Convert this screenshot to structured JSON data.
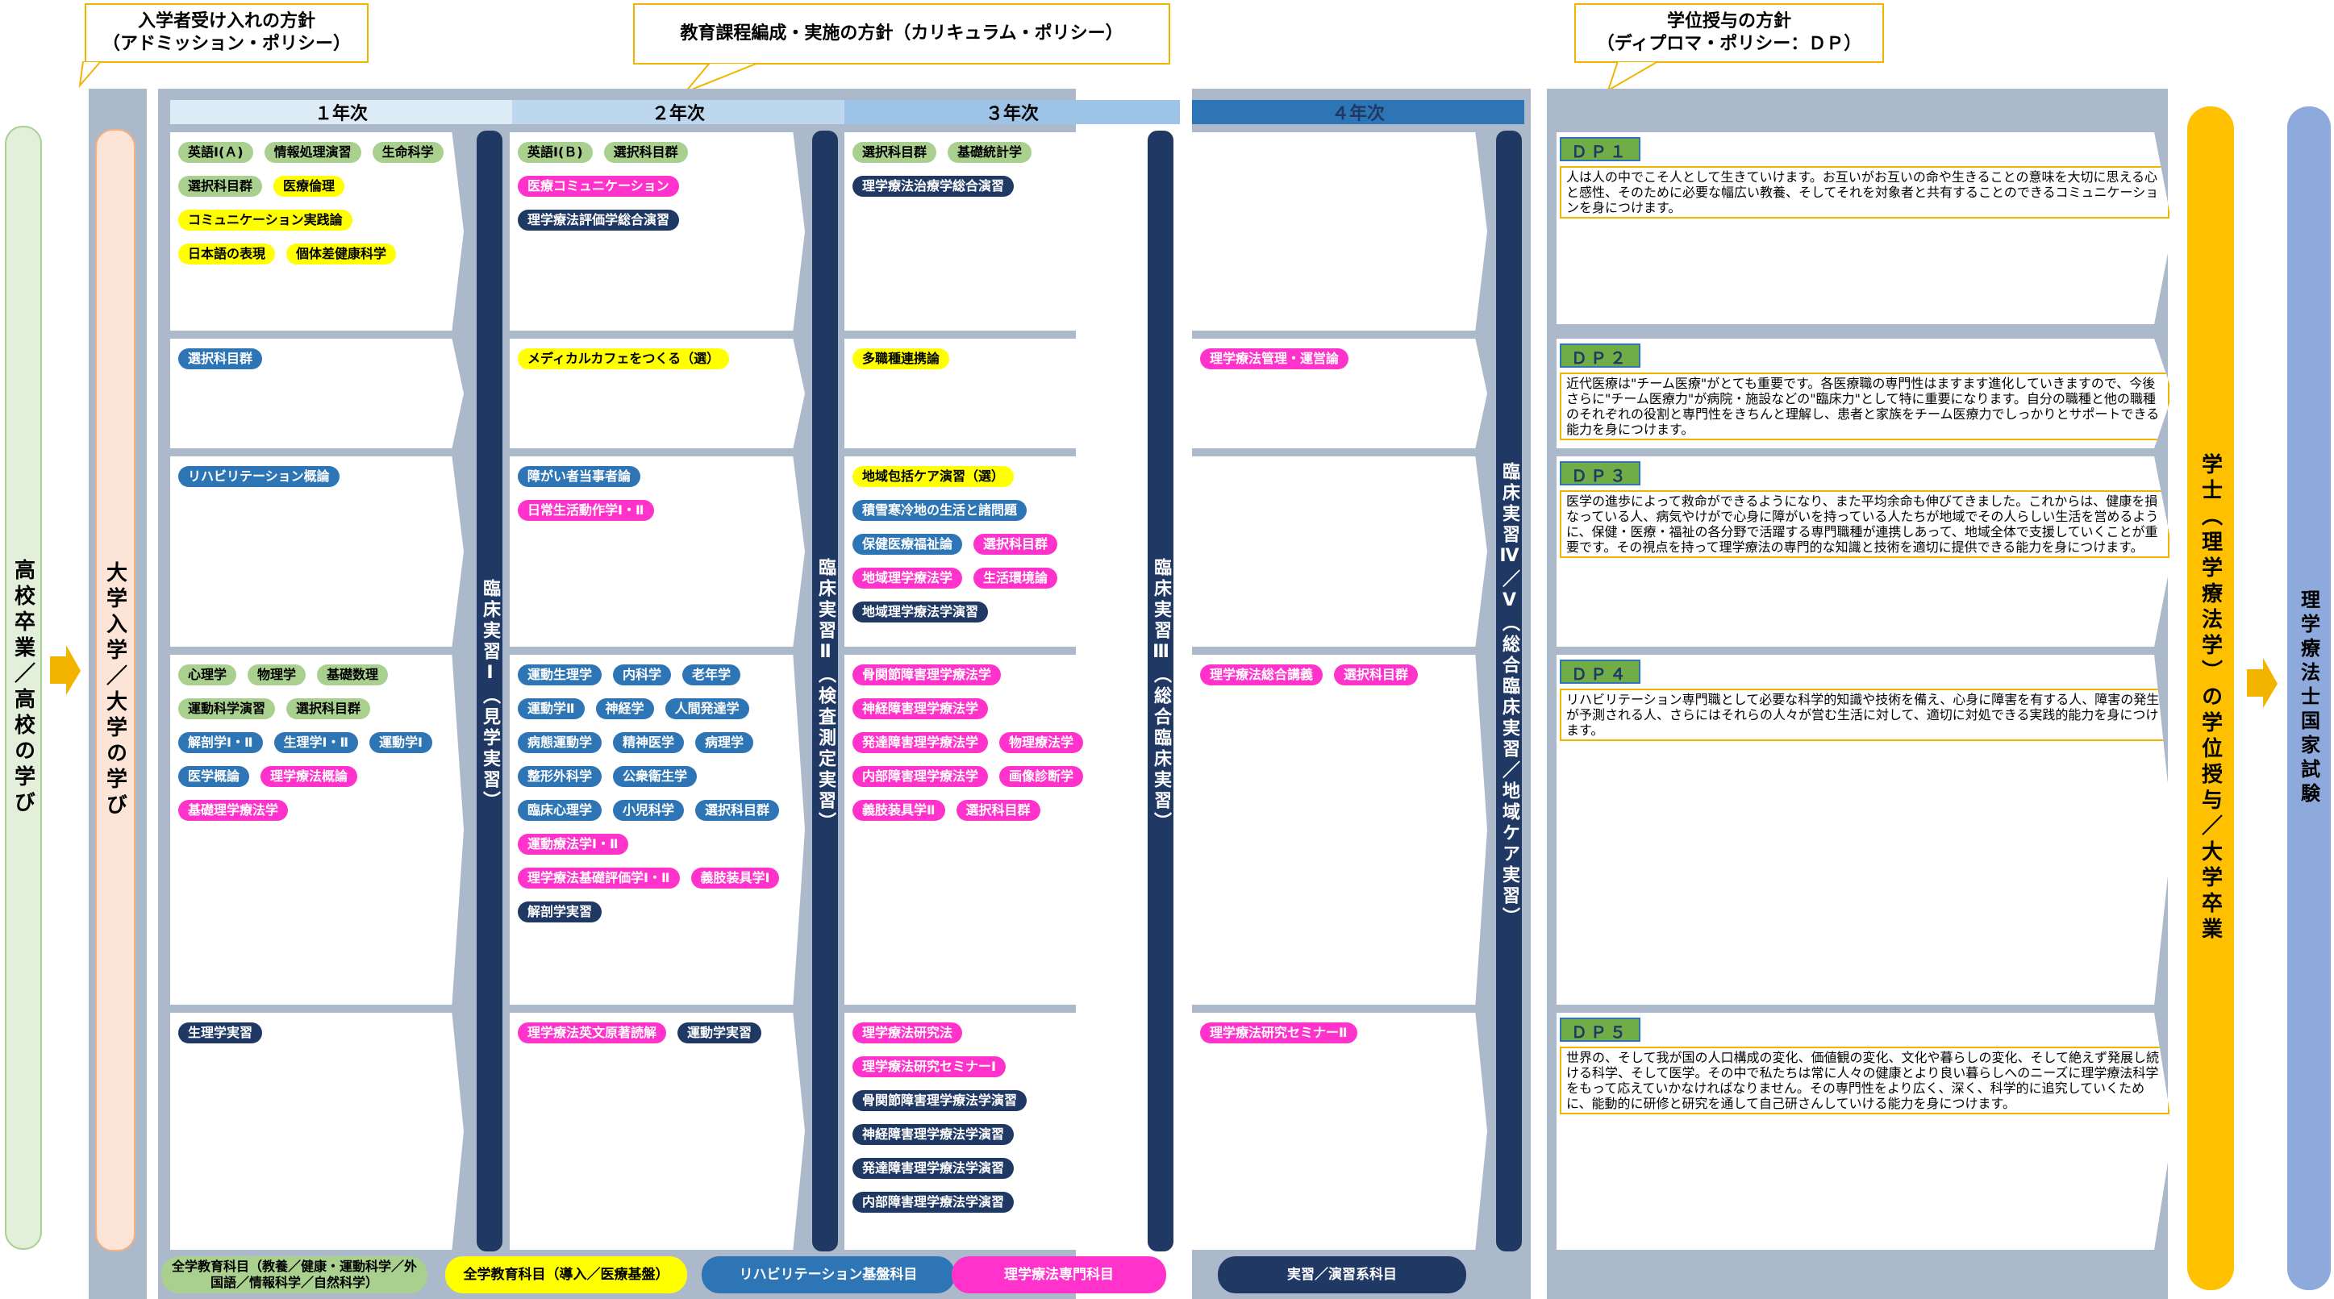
{
  "callouts": {
    "admission": "入学者受け入れの方針\n（アドミッション・ポリシー）",
    "curriculum": "教育課程編成・実施の方針（カリキュラム・ポリシー）",
    "diploma": "学位授与の方針\n（ディプロマ・ポリシー：ＤＰ）"
  },
  "left": {
    "highschool": "高校卒業／高校の学び",
    "university": "大学入学／大学の学び"
  },
  "years": [
    "１年次",
    "２年次",
    "３年次",
    "４年次"
  ],
  "practicum": {
    "p1": "臨床実習Ⅰ（見学実習）",
    "p2": "臨床実習Ⅱ（検査測定実習）",
    "p3": "臨床実習Ⅲ（総合臨床実習）",
    "p45": "臨床実習Ⅳ／Ⅴ（総合臨床実習／地域ケア実習）"
  },
  "grid": {
    "y1": [
      [
        [
          "英語Ⅰ(Ａ)",
          "green"
        ],
        [
          "情報処理演習",
          "green"
        ],
        [
          "生命科学",
          "green"
        ],
        [
          "選択科目群",
          "green"
        ],
        [
          "医療倫理",
          "yellow"
        ],
        [
          "コミュニケーション実践論",
          "yellow"
        ],
        [
          "日本語の表現",
          "yellow"
        ],
        [
          "個体差健康科学",
          "yellow"
        ]
      ],
      [
        [
          "選択科目群",
          "blue"
        ]
      ],
      [
        [
          "リハビリテーション概論",
          "blue"
        ]
      ],
      [
        [
          "心理学",
          "green"
        ],
        [
          "物理学",
          "green"
        ],
        [
          "基礎数理",
          "green"
        ],
        [
          "運動科学演習",
          "green"
        ],
        [
          "選択科目群",
          "green"
        ],
        [
          "解剖学Ⅰ・Ⅱ",
          "blue"
        ],
        [
          "生理学Ⅰ・Ⅱ",
          "blue"
        ],
        [
          "運動学Ⅰ",
          "blue"
        ],
        [
          "医学概論",
          "blue"
        ],
        [
          "理学療法概論",
          "pink"
        ],
        [
          "基礎理学療法学",
          "pink"
        ]
      ],
      [
        [
          "生理学実習",
          "navy"
        ]
      ]
    ],
    "y2": [
      [
        [
          "英語Ⅰ(Ｂ)",
          "green"
        ],
        [
          "選択科目群",
          "green"
        ],
        [
          "医療コミュニケーション",
          "pink"
        ],
        [
          "理学療法評価学総合演習",
          "navy"
        ]
      ],
      [
        [
          "メディカルカフェをつくる（選）",
          "yellow"
        ]
      ],
      [
        [
          "障がい者当事者論",
          "blue"
        ],
        [
          "日常生活動作学Ⅰ・Ⅱ",
          "pink"
        ]
      ],
      [
        [
          "運動生理学",
          "blue"
        ],
        [
          "内科学",
          "blue"
        ],
        [
          "老年学",
          "blue"
        ],
        [
          "運動学Ⅱ",
          "blue"
        ],
        [
          "神経学",
          "blue"
        ],
        [
          "人間発達学",
          "blue"
        ],
        [
          "病態運動学",
          "blue"
        ],
        [
          "精神医学",
          "blue"
        ],
        [
          "病理学",
          "blue"
        ],
        [
          "整形外科学",
          "blue"
        ],
        [
          "公衆衛生学",
          "blue"
        ],
        [
          "臨床心理学",
          "blue"
        ],
        [
          "小児科学",
          "blue"
        ],
        [
          "選択科目群",
          "blue"
        ],
        [
          "運動療法学Ⅰ・Ⅱ",
          "pink"
        ],
        [
          "理学療法基礎評価学Ⅰ・Ⅱ",
          "pink"
        ],
        [
          "義肢装具学Ⅰ",
          "pink"
        ],
        [
          "解剖学実習",
          "navy"
        ]
      ],
      [
        [
          "理学療法英文原著読解",
          "pink"
        ],
        [
          "運動学実習",
          "navy"
        ]
      ]
    ],
    "y3": [
      [
        [
          "選択科目群",
          "green"
        ],
        [
          "基礎統計学",
          "green"
        ],
        [
          "理学療法治療学総合演習",
          "navy"
        ]
      ],
      [
        [
          "多職種連携論",
          "yellow"
        ]
      ],
      [
        [
          "地域包括ケア演習（選）",
          "yellow"
        ],
        [
          "積雪寒冷地の生活と諸問題",
          "blue"
        ],
        [
          "保健医療福祉論",
          "blue"
        ],
        [
          "選択科目群",
          "pink"
        ],
        [
          "地域理学療法学",
          "pink"
        ],
        [
          "生活環境論",
          "pink"
        ],
        [
          "地域理学療法学演習",
          "navy"
        ]
      ],
      [
        [
          "骨関節障害理学療法学",
          "pink"
        ],
        [
          "神経障害理学療法学",
          "pink"
        ],
        [
          "発達障害理学療法学",
          "pink"
        ],
        [
          "物理療法学",
          "pink"
        ],
        [
          "内部障害理学療法学",
          "pink"
        ],
        [
          "画像診断学",
          "pink"
        ],
        [
          "義肢装具学Ⅱ",
          "pink"
        ],
        [
          "選択科目群",
          "pink"
        ]
      ],
      [
        [
          "理学療法研究法",
          "pink"
        ],
        [
          "理学療法研究セミナーⅠ",
          "pink"
        ],
        [
          "骨関節障害理学療法学演習",
          "navy"
        ],
        [
          "神経障害理学療法学演習",
          "navy"
        ],
        [
          "発達障害理学療法学演習",
          "navy"
        ],
        [
          "内部障害理学療法学演習",
          "navy"
        ]
      ]
    ],
    "y4": [
      [],
      [
        [
          "理学療法管理・運営論",
          "pink"
        ]
      ],
      [],
      [
        [
          "理学療法総合講義",
          "pink"
        ],
        [
          "選択科目群",
          "pink"
        ]
      ],
      [
        [
          "理学療法研究セミナーⅡ",
          "pink"
        ]
      ]
    ]
  },
  "dp": [
    {
      "tag": "ＤＰ１",
      "text": "人は人の中でこそ人として生きていけます。お互いがお互いの命や生きることの意味を大切に思える心と感性、そのために必要な幅広い教養、そしてそれを対象者と共有することのできるコミュニケーションを身につけます。"
    },
    {
      "tag": "ＤＰ２",
      "text": "近代医療は\"チーム医療\"がとても重要です。各医療職の専門性はますます進化していきますので、今後さらに\"チーム医療力\"が病院・施設などの\"臨床力\"として特に重要になります。自分の職種と他の職種のそれぞれの役割と専門性をきちんと理解し、患者と家族をチーム医療力でしっかりとサポートできる能力を身につけます。"
    },
    {
      "tag": "ＤＰ３",
      "text": "医学の進歩によって救命ができるようになり、また平均余命も伸びてきました。これからは、健康を損なっている人、病気やけがで心身に障がいを持っている人たちが地域でその人らしい生活を営めるように、保健・医療・福祉の各分野で活躍する専門職種が連携しあって、地域全体で支援していくことが重要です。その視点を持って理学療法の専門的な知識と技術を適切に提供できる能力を身につけます。"
    },
    {
      "tag": "ＤＰ４",
      "text": "リハビリテーション専門職として必要な科学的知識や技術を備え、心身に障害を有する人、障害の発生が予測される人、さらにはそれらの人々が営む生活に対して、適切に対処できる実践的能力を身につけます。"
    },
    {
      "tag": "ＤＰ５",
      "text": "世界の、そして我が国の人口構成の変化、価値観の変化、文化や暮らしの変化、そして絶えず発展し続ける科学、そして医学。その中で私たちは常に人々の健康とより良い暮らしへのニーズに理学療法科学をもって応えていかなければなりません。その専門性をより広く、深く、科学的に追究していくために、能動的に研修と研究を通して自己研さんしていける能力を身につけます。"
    }
  ],
  "right": {
    "degree": "学士（理学療法学）の学位授与／大学卒業",
    "exam": "理学療法士国家試験"
  },
  "legend": {
    "green": "全学教育科目（教養／健康・運動科学／外国語／情報科学／自然科学）",
    "yellow": "全学教育科目（導入／医療基盤）",
    "blue": "リハビリテーション基盤科目",
    "pink": "理学療法専門科目",
    "navy": "実習／演習系科目"
  }
}
